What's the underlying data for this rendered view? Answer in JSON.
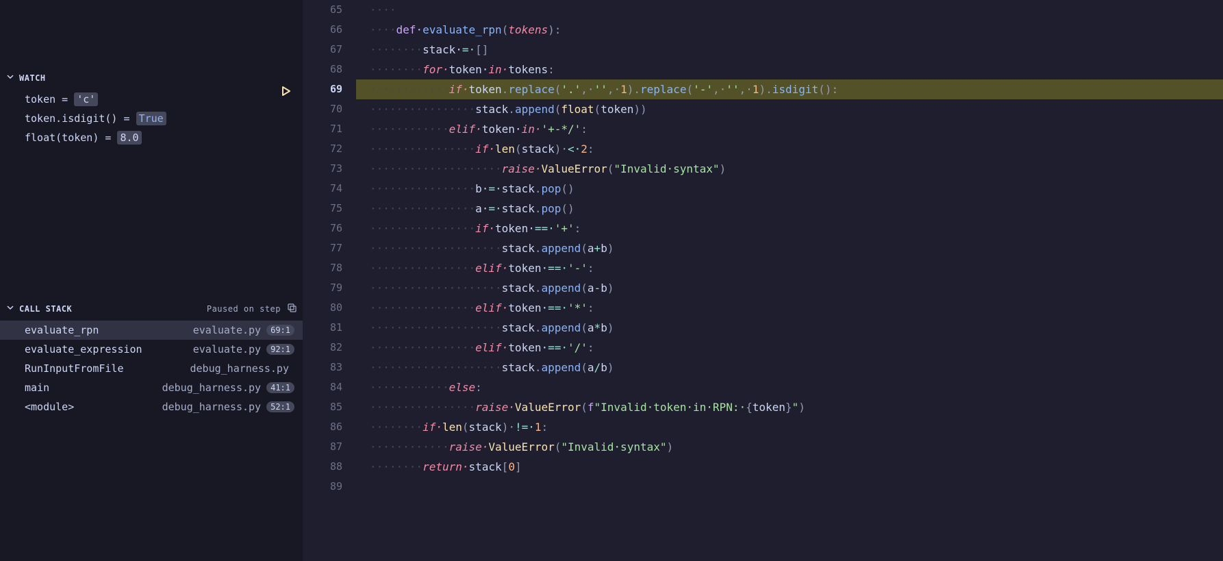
{
  "sidebar": {
    "watch": {
      "title": "WATCH",
      "items": [
        {
          "expr": "token",
          "value": "'c'",
          "value_class": "val-str"
        },
        {
          "expr": "token.isdigit()",
          "value": "True",
          "value_class": "val-bool"
        },
        {
          "expr": "float(token)",
          "value": "8.0",
          "value_class": "val-num"
        }
      ]
    },
    "call_stack": {
      "title": "CALL STACK",
      "status": "Paused on step",
      "items": [
        {
          "fn": "evaluate_rpn",
          "file": "evaluate.py",
          "pos": "69:1",
          "selected": true
        },
        {
          "fn": "evaluate_expression",
          "file": "evaluate.py",
          "pos": "92:1",
          "selected": false
        },
        {
          "fn": "RunInputFromFile",
          "file": "debug_harness.py",
          "pos": "",
          "selected": false
        },
        {
          "fn": "main",
          "file": "debug_harness.py",
          "pos": "41:1",
          "selected": false
        },
        {
          "fn": "<module>",
          "file": "debug_harness.py",
          "pos": "52:1",
          "selected": false
        }
      ]
    }
  },
  "editor": {
    "current_line": 69,
    "lines": [
      {
        "n": 65,
        "indent": 1,
        "tokens": []
      },
      {
        "n": 66,
        "indent": 1,
        "tokens": [
          {
            "t": "def ",
            "c": "kw"
          },
          {
            "t": "evaluate_rpn",
            "c": "fn-def"
          },
          {
            "t": "(",
            "c": "punct"
          },
          {
            "t": "tokens",
            "c": "param"
          },
          {
            "t": ")",
            "c": "punct"
          },
          {
            "t": ":",
            "c": "punct"
          }
        ]
      },
      {
        "n": 67,
        "indent": 2,
        "tokens": [
          {
            "t": "stack ",
            "c": "var"
          },
          {
            "t": "= ",
            "c": "op"
          },
          {
            "t": "[",
            "c": "punct"
          },
          {
            "t": "]",
            "c": "punct"
          }
        ]
      },
      {
        "n": 68,
        "indent": 2,
        "tokens": [
          {
            "t": "for ",
            "c": "kw2"
          },
          {
            "t": "token ",
            "c": "var"
          },
          {
            "t": "in ",
            "c": "kw2"
          },
          {
            "t": "tokens",
            "c": "var"
          },
          {
            "t": ":",
            "c": "punct"
          }
        ]
      },
      {
        "n": 69,
        "indent": 3,
        "highlight": true,
        "tokens": [
          {
            "t": "if ",
            "c": "kw2"
          },
          {
            "t": "token",
            "c": "var"
          },
          {
            "t": ".",
            "c": "punct"
          },
          {
            "t": "replace",
            "c": "fn-call"
          },
          {
            "t": "(",
            "c": "punct"
          },
          {
            "t": "'.'",
            "c": "str"
          },
          {
            "t": ", ",
            "c": "punct"
          },
          {
            "t": "''",
            "c": "str"
          },
          {
            "t": ", ",
            "c": "punct"
          },
          {
            "t": "1",
            "c": "num"
          },
          {
            "t": ")",
            "c": "punct"
          },
          {
            "t": ".",
            "c": "punct"
          },
          {
            "t": "replace",
            "c": "fn-call"
          },
          {
            "t": "(",
            "c": "punct"
          },
          {
            "t": "'-'",
            "c": "str"
          },
          {
            "t": ", ",
            "c": "punct"
          },
          {
            "t": "''",
            "c": "str"
          },
          {
            "t": ", ",
            "c": "punct"
          },
          {
            "t": "1",
            "c": "num"
          },
          {
            "t": ")",
            "c": "punct"
          },
          {
            "t": ".",
            "c": "punct"
          },
          {
            "t": "isdigit",
            "c": "fn-call"
          },
          {
            "t": "(",
            "c": "punct"
          },
          {
            "t": ")",
            "c": "punct"
          },
          {
            "t": ":",
            "c": "punct"
          }
        ]
      },
      {
        "n": 70,
        "indent": 4,
        "tokens": [
          {
            "t": "stack",
            "c": "var"
          },
          {
            "t": ".",
            "c": "punct"
          },
          {
            "t": "append",
            "c": "fn-call"
          },
          {
            "t": "(",
            "c": "punct"
          },
          {
            "t": "float",
            "c": "builtin"
          },
          {
            "t": "(",
            "c": "punct"
          },
          {
            "t": "token",
            "c": "var"
          },
          {
            "t": ")",
            "c": "punct"
          },
          {
            "t": ")",
            "c": "punct"
          }
        ]
      },
      {
        "n": 71,
        "indent": 3,
        "tokens": [
          {
            "t": "elif ",
            "c": "kw2"
          },
          {
            "t": "token ",
            "c": "var"
          },
          {
            "t": "in ",
            "c": "kw2"
          },
          {
            "t": "'+-*/'",
            "c": "str"
          },
          {
            "t": ":",
            "c": "punct"
          }
        ]
      },
      {
        "n": 72,
        "indent": 4,
        "tokens": [
          {
            "t": "if ",
            "c": "kw2"
          },
          {
            "t": "len",
            "c": "builtin"
          },
          {
            "t": "(",
            "c": "punct"
          },
          {
            "t": "stack",
            "c": "var"
          },
          {
            "t": ") ",
            "c": "punct"
          },
          {
            "t": "< ",
            "c": "op"
          },
          {
            "t": "2",
            "c": "num"
          },
          {
            "t": ":",
            "c": "punct"
          }
        ]
      },
      {
        "n": 73,
        "indent": 5,
        "tokens": [
          {
            "t": "raise ",
            "c": "kw2"
          },
          {
            "t": "ValueError",
            "c": "builtin"
          },
          {
            "t": "(",
            "c": "punct"
          },
          {
            "t": "\"Invalid syntax\"",
            "c": "str"
          },
          {
            "t": ")",
            "c": "punct"
          }
        ]
      },
      {
        "n": 74,
        "indent": 4,
        "tokens": [
          {
            "t": "b ",
            "c": "var"
          },
          {
            "t": "= ",
            "c": "op"
          },
          {
            "t": "stack",
            "c": "var"
          },
          {
            "t": ".",
            "c": "punct"
          },
          {
            "t": "pop",
            "c": "fn-call"
          },
          {
            "t": "(",
            "c": "punct"
          },
          {
            "t": ")",
            "c": "punct"
          }
        ]
      },
      {
        "n": 75,
        "indent": 4,
        "tokens": [
          {
            "t": "a ",
            "c": "var"
          },
          {
            "t": "= ",
            "c": "op"
          },
          {
            "t": "stack",
            "c": "var"
          },
          {
            "t": ".",
            "c": "punct"
          },
          {
            "t": "pop",
            "c": "fn-call"
          },
          {
            "t": "(",
            "c": "punct"
          },
          {
            "t": ")",
            "c": "punct"
          }
        ]
      },
      {
        "n": 76,
        "indent": 4,
        "tokens": [
          {
            "t": "if ",
            "c": "kw2"
          },
          {
            "t": "token ",
            "c": "var"
          },
          {
            "t": "== ",
            "c": "op"
          },
          {
            "t": "'+'",
            "c": "str"
          },
          {
            "t": ":",
            "c": "punct"
          }
        ]
      },
      {
        "n": 77,
        "indent": 5,
        "tokens": [
          {
            "t": "stack",
            "c": "var"
          },
          {
            "t": ".",
            "c": "punct"
          },
          {
            "t": "append",
            "c": "fn-call"
          },
          {
            "t": "(",
            "c": "punct"
          },
          {
            "t": "a",
            "c": "var"
          },
          {
            "t": "+",
            "c": "op"
          },
          {
            "t": "b",
            "c": "var"
          },
          {
            "t": ")",
            "c": "punct"
          }
        ]
      },
      {
        "n": 78,
        "indent": 4,
        "tokens": [
          {
            "t": "elif ",
            "c": "kw2"
          },
          {
            "t": "token ",
            "c": "var"
          },
          {
            "t": "== ",
            "c": "op"
          },
          {
            "t": "'-'",
            "c": "str"
          },
          {
            "t": ":",
            "c": "punct"
          }
        ]
      },
      {
        "n": 79,
        "indent": 5,
        "tokens": [
          {
            "t": "stack",
            "c": "var"
          },
          {
            "t": ".",
            "c": "punct"
          },
          {
            "t": "append",
            "c": "fn-call"
          },
          {
            "t": "(",
            "c": "punct"
          },
          {
            "t": "a",
            "c": "var"
          },
          {
            "t": "-",
            "c": "op"
          },
          {
            "t": "b",
            "c": "var"
          },
          {
            "t": ")",
            "c": "punct"
          }
        ]
      },
      {
        "n": 80,
        "indent": 4,
        "tokens": [
          {
            "t": "elif ",
            "c": "kw2"
          },
          {
            "t": "token ",
            "c": "var"
          },
          {
            "t": "== ",
            "c": "op"
          },
          {
            "t": "'*'",
            "c": "str"
          },
          {
            "t": ":",
            "c": "punct"
          }
        ]
      },
      {
        "n": 81,
        "indent": 5,
        "tokens": [
          {
            "t": "stack",
            "c": "var"
          },
          {
            "t": ".",
            "c": "punct"
          },
          {
            "t": "append",
            "c": "fn-call"
          },
          {
            "t": "(",
            "c": "punct"
          },
          {
            "t": "a",
            "c": "var"
          },
          {
            "t": "*",
            "c": "op"
          },
          {
            "t": "b",
            "c": "var"
          },
          {
            "t": ")",
            "c": "punct"
          }
        ]
      },
      {
        "n": 82,
        "indent": 4,
        "tokens": [
          {
            "t": "elif ",
            "c": "kw2"
          },
          {
            "t": "token ",
            "c": "var"
          },
          {
            "t": "== ",
            "c": "op"
          },
          {
            "t": "'/'",
            "c": "str"
          },
          {
            "t": ":",
            "c": "punct"
          }
        ]
      },
      {
        "n": 83,
        "indent": 5,
        "tokens": [
          {
            "t": "stack",
            "c": "var"
          },
          {
            "t": ".",
            "c": "punct"
          },
          {
            "t": "append",
            "c": "fn-call"
          },
          {
            "t": "(",
            "c": "punct"
          },
          {
            "t": "a",
            "c": "var"
          },
          {
            "t": "/",
            "c": "op"
          },
          {
            "t": "b",
            "c": "var"
          },
          {
            "t": ")",
            "c": "punct"
          }
        ]
      },
      {
        "n": 84,
        "indent": 3,
        "tokens": [
          {
            "t": "else",
            "c": "kw2"
          },
          {
            "t": ":",
            "c": "punct"
          }
        ]
      },
      {
        "n": 85,
        "indent": 4,
        "tokens": [
          {
            "t": "raise ",
            "c": "kw2"
          },
          {
            "t": "ValueError",
            "c": "builtin"
          },
          {
            "t": "(",
            "c": "punct"
          },
          {
            "t": "f",
            "c": "kw"
          },
          {
            "t": "\"Invalid token in RPN: ",
            "c": "str"
          },
          {
            "t": "{",
            "c": "punct"
          },
          {
            "t": "token",
            "c": "var"
          },
          {
            "t": "}",
            "c": "punct"
          },
          {
            "t": "\"",
            "c": "str"
          },
          {
            "t": ")",
            "c": "punct"
          }
        ]
      },
      {
        "n": 86,
        "indent": 2,
        "tokens": [
          {
            "t": "if ",
            "c": "kw2"
          },
          {
            "t": "len",
            "c": "builtin"
          },
          {
            "t": "(",
            "c": "punct"
          },
          {
            "t": "stack",
            "c": "var"
          },
          {
            "t": ") ",
            "c": "punct"
          },
          {
            "t": "!= ",
            "c": "op"
          },
          {
            "t": "1",
            "c": "num"
          },
          {
            "t": ":",
            "c": "punct"
          }
        ]
      },
      {
        "n": 87,
        "indent": 3,
        "tokens": [
          {
            "t": "raise ",
            "c": "kw2"
          },
          {
            "t": "ValueError",
            "c": "builtin"
          },
          {
            "t": "(",
            "c": "punct"
          },
          {
            "t": "\"Invalid syntax\"",
            "c": "str"
          },
          {
            "t": ")",
            "c": "punct"
          }
        ]
      },
      {
        "n": 88,
        "indent": 2,
        "tokens": [
          {
            "t": "return ",
            "c": "kw2"
          },
          {
            "t": "stack",
            "c": "var"
          },
          {
            "t": "[",
            "c": "punct"
          },
          {
            "t": "0",
            "c": "num"
          },
          {
            "t": "]",
            "c": "punct"
          }
        ]
      },
      {
        "n": 89,
        "indent": 0,
        "tokens": []
      }
    ]
  }
}
